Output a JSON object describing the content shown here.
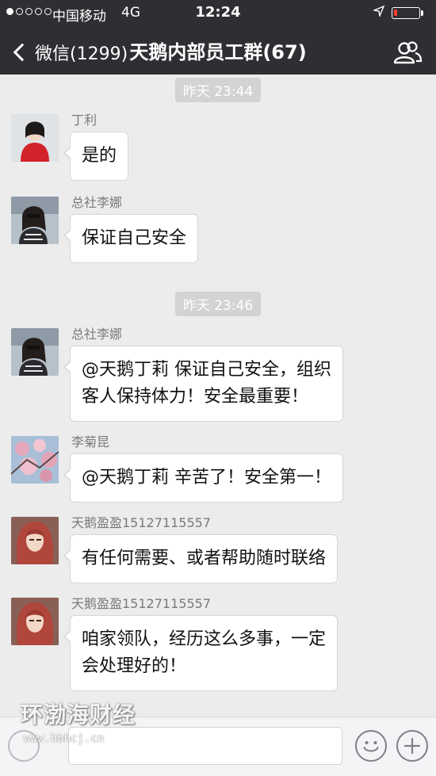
{
  "status_bar": {
    "carrier": "中国移动",
    "network": "4G",
    "time": "12:24",
    "battery_level": 0.15,
    "battery_color": "#ff3b30"
  },
  "nav": {
    "back_label": "微信(1299)",
    "title": "天鹅内部员工群(67)",
    "group_icon": "group-members-icon"
  },
  "chat": {
    "timestamps": [
      "昨天 23:44",
      "昨天 23:46"
    ],
    "messages": [
      {
        "sender": "丁利",
        "lines": [
          "是的"
        ]
      },
      {
        "sender": "总社李娜",
        "lines": [
          "保证自己安全"
        ]
      },
      {
        "sender": "总社李娜",
        "lines": [
          "@天鹅丁莉 保证自己安全，组织",
          "客人保持体力！安全最重要！"
        ]
      },
      {
        "sender": "李菊昆",
        "lines": [
          "@天鹅丁莉 辛苦了！安全第一！"
        ]
      },
      {
        "sender": "天鹅盈盈15127115557",
        "lines": [
          "有任何需要、或者帮助随时联络"
        ]
      },
      {
        "sender": "天鹅盈盈15127115557",
        "lines": [
          "咱家领队，经历这么多事，一定",
          "会处理好的！"
        ]
      }
    ]
  },
  "input_bar": {
    "emoji_icon": "emoji-icon",
    "plus_icon": "plus-icon"
  },
  "watermark": {
    "name": "环渤海财经",
    "url": "www.hbhcj.cn"
  },
  "colors": {
    "nav_background": "#2f2f33",
    "chat_background": "#ececec"
  }
}
